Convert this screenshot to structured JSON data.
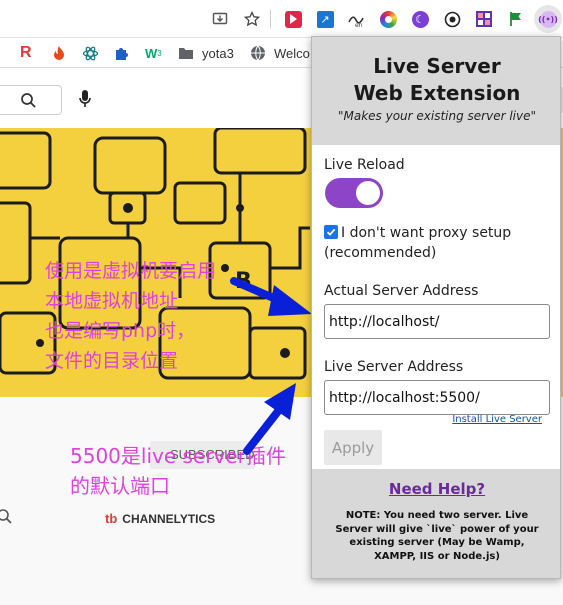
{
  "bookmarks": {
    "folder_label": "yota3",
    "welcome_label": "Welco"
  },
  "page": {
    "subscribed_label": "SUBSCRIBED",
    "channel_label": "CHANNELYTICS"
  },
  "annotations": {
    "top_lines": [
      "使用是虚拟机要启用",
      "本地虚拟机地址",
      "也是编写php时，",
      "文件的目录位置"
    ],
    "bottom_lines": [
      "5500是live server插件",
      "的默认端口"
    ],
    "color": "#e040e0",
    "arrow_color": "#0a1fd8"
  },
  "popup": {
    "title": "Live Server\nWeb Extension",
    "subtitle": "\"Makes your existing server live\"",
    "live_reload_label": "Live Reload",
    "live_reload_on": true,
    "proxy_checkbox_label_1": "I don't want proxy setup",
    "proxy_checkbox_label_2": "(recommended)",
    "proxy_checked": true,
    "actual_label": "Actual Server Address",
    "actual_value": "http://localhost/",
    "live_label": "Live Server Address",
    "live_value": "http://localhost:5500/",
    "install_link": "Install Live Server",
    "apply_label": "Apply",
    "need_help": "Need Help?",
    "note": "NOTE: You need two server. Live Server will give `live` power of your existing server (May be Wamp, XAMPP, IIS or Node.js)",
    "toggle_color": "#8e44c7"
  }
}
